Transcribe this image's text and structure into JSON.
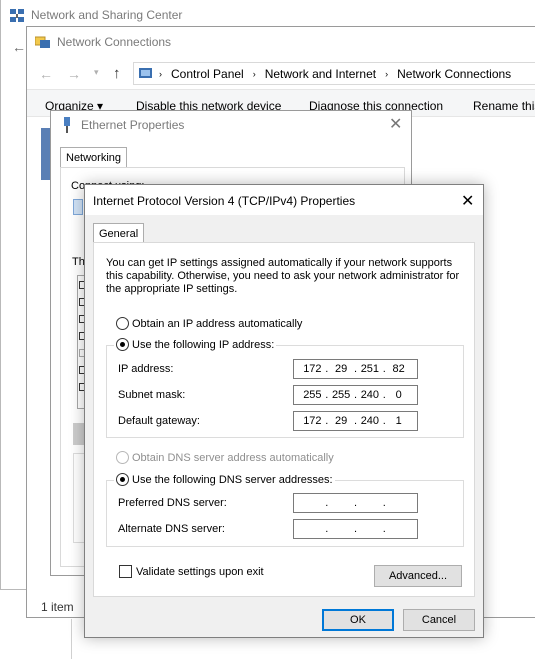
{
  "nsc": {
    "title": "Network and Sharing Center"
  },
  "nc": {
    "title": "Network Connections",
    "breadcrumb": [
      "Control Panel",
      "Network and Internet",
      "Network Connections"
    ],
    "commands": [
      "Organize ▾",
      "Disable this network device",
      "Diagnose this connection",
      "Rename this"
    ],
    "status_count": "1 item"
  },
  "eth": {
    "title": "Ethernet Properties",
    "tab": "Networking",
    "connect_label": "Connect using:",
    "this_label": "Th"
  },
  "ipv4": {
    "title": "Internet Protocol Version 4 (TCP/IPv4) Properties",
    "tab": "General",
    "intro": "You can get IP settings assigned automatically if your network supports this capability. Otherwise, you need to ask your network administrator for the appropriate IP settings.",
    "auto_ip": "Obtain an IP address automatically",
    "manual_ip": "Use the following IP address:",
    "ip_label": "IP address:",
    "ip": [
      "172",
      "29",
      "251",
      "82"
    ],
    "mask_label": "Subnet mask:",
    "mask": [
      "255",
      "255",
      "240",
      "0"
    ],
    "gateway_label": "Default gateway:",
    "gateway": [
      "172",
      "29",
      "240",
      "1"
    ],
    "auto_dns": "Obtain DNS server address automatically",
    "manual_dns": "Use the following DNS server addresses:",
    "pref_dns_label": "Preferred DNS server:",
    "alt_dns_label": "Alternate DNS server:",
    "validate": "Validate settings upon exit",
    "advanced": "Advanced...",
    "ok": "OK",
    "cancel": "Cancel"
  }
}
